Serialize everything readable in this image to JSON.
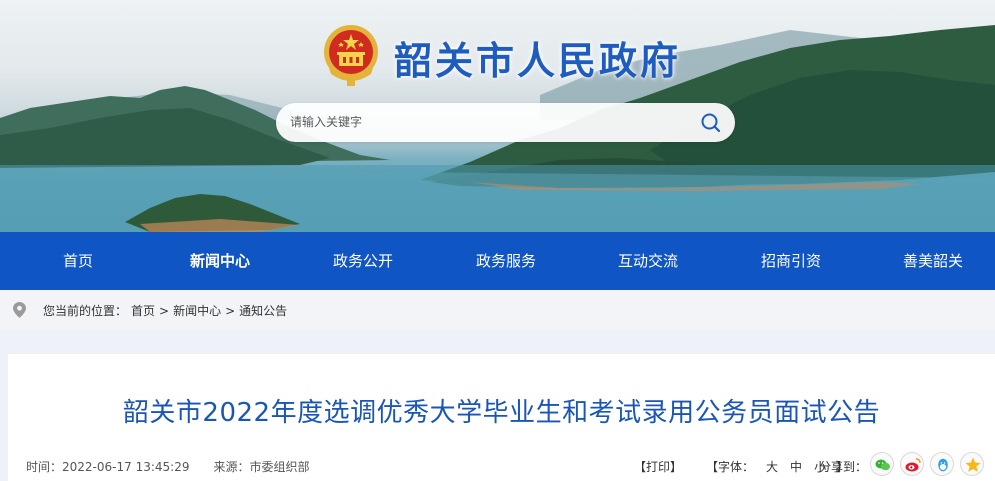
{
  "site": {
    "title": "韶关市人民政府"
  },
  "search": {
    "placeholder": "请输入关键字"
  },
  "nav": [
    {
      "label": "首页"
    },
    {
      "label": "新闻中心",
      "active": true
    },
    {
      "label": "政务公开"
    },
    {
      "label": "政务服务"
    },
    {
      "label": "互动交流"
    },
    {
      "label": "招商引资"
    },
    {
      "label": "善美韶关"
    }
  ],
  "breadcrumb": {
    "prefix": "您当前的位置：",
    "items": [
      "首页",
      "新闻中心",
      "通知公告"
    ],
    "separator": ">"
  },
  "article": {
    "title": "韶关市2022年度选调优秀大学毕业生和考试录用公务员面试公告",
    "time_label": "时间：",
    "time": "2022-06-17 13:45:29",
    "source_label": "来源：",
    "source": "市委组织部",
    "print": "【打印】",
    "font_prefix": "【字体：",
    "font_large": "大",
    "font_medium": "中",
    "font_small": "小",
    "font_suffix": "】",
    "share_label": "分享到："
  },
  "share_icons": [
    "wechat-icon",
    "weibo-icon",
    "qq-icon",
    "qzone-icon"
  ],
  "colors": {
    "nav_bg": "#0f55c4",
    "title_blue": "#1f5cc0",
    "headline_blue": "#1a56b5"
  }
}
